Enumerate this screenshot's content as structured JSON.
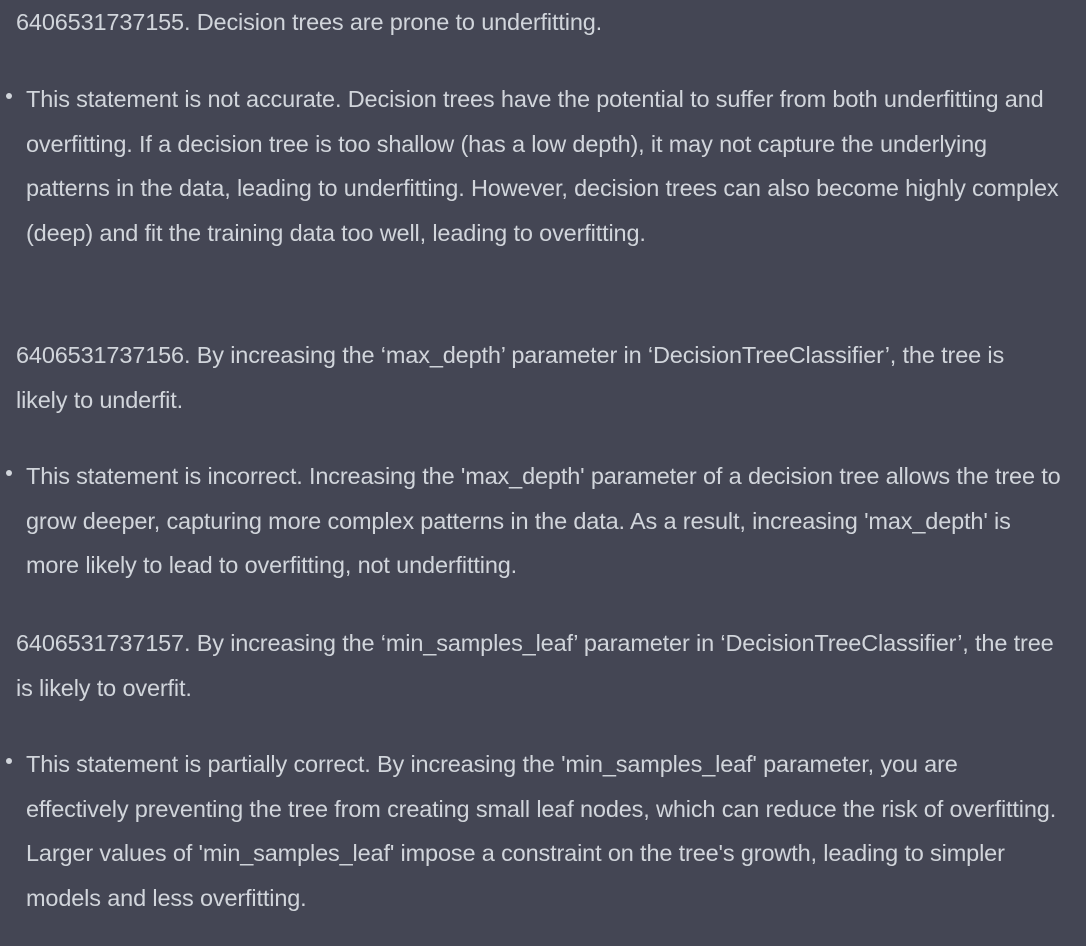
{
  "items": [
    {
      "question": "6406531737155. Decision trees are prone to underfitting.",
      "answer": "This statement is not accurate. Decision trees have the potential to suffer from both underfitting and overfitting. If a decision tree is too shallow (has a low depth), it may not capture the underlying patterns in the data, leading to underfitting. However, decision trees can also become highly complex (deep) and fit the training data too well, leading to overfitting."
    },
    {
      "question": "6406531737156. By increasing the ‘max_depth’ parameter in ‘DecisionTreeClassifier’, the tree is likely to underfit.",
      "answer": "This statement is incorrect. Increasing the 'max_depth' parameter of a decision tree allows the tree to grow deeper, capturing more complex patterns in the data. As a result, increasing 'max_depth' is more likely to lead to overfitting, not underfitting."
    },
    {
      "question": "6406531737157. By increasing the ‘min_samples_leaf’ parameter in ‘DecisionTreeClassifier’, the tree is likely to overfit.",
      "answer": "This statement is partially correct. By increasing the 'min_samples_leaf' parameter, you are effectively preventing the tree from creating small leaf nodes, which can reduce the risk of overfitting. Larger values of 'min_samples_leaf' impose a constraint on the tree's growth, leading to simpler models and less overfitting."
    }
  ]
}
